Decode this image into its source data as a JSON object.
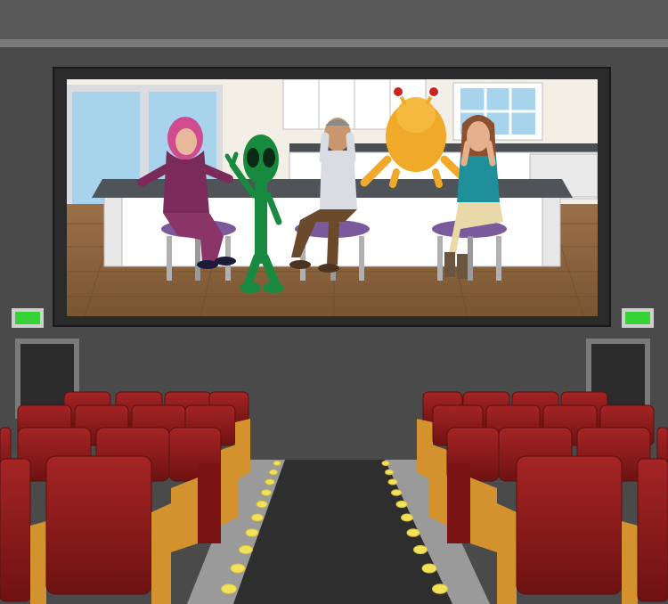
{
  "scene": {
    "setting": "movie-theater",
    "palette": {
      "wall": "#4a4a4a",
      "ceiling": "#595959",
      "screen_frame": "#2a2a2a",
      "seat_red": "#8e1c1c",
      "seat_arm": "#d4922f",
      "aisle_light": "#f2e15a",
      "exit_light": "#35d335"
    }
  },
  "screen_content": {
    "room": "kitchen",
    "characters": [
      {
        "name": "woman-in-hijab",
        "color": "#d14b8f"
      },
      {
        "name": "green-alien",
        "color": "#178a3f"
      },
      {
        "name": "frightened-man",
        "color": "#8a8a8a"
      },
      {
        "name": "orange-creature",
        "color": "#f0a928"
      },
      {
        "name": "frightened-woman",
        "color": "#1f8f9a"
      }
    ]
  }
}
